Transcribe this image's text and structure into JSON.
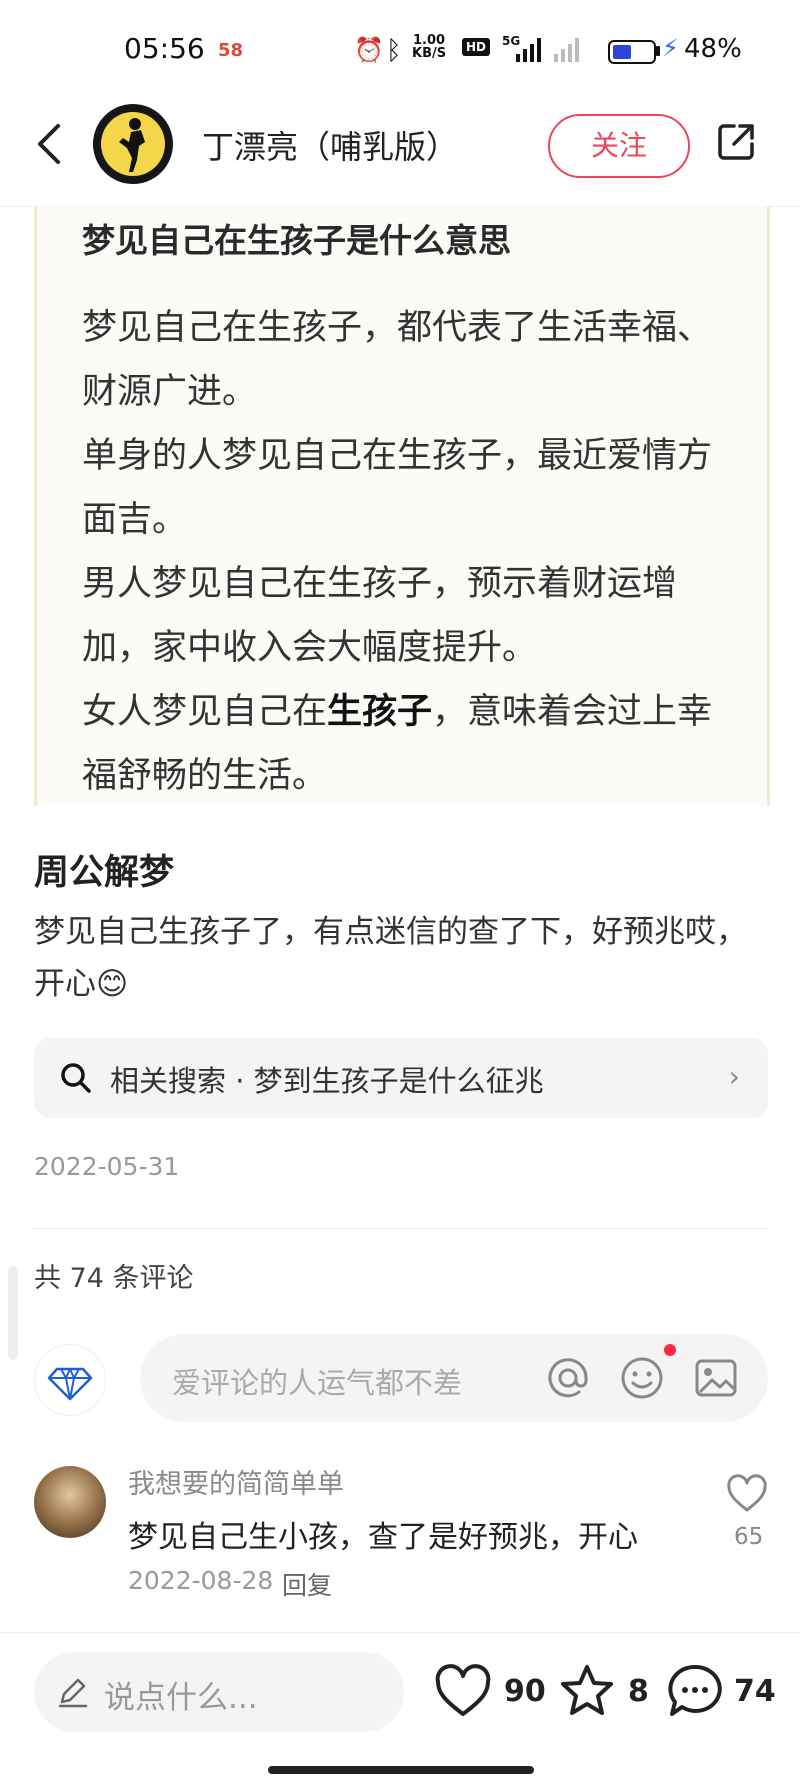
{
  "status_bar": {
    "time": "05:56",
    "notif_badge": "58",
    "net_speed_top": "1.00",
    "net_speed_unit": "KB/S",
    "hd_label": "HD",
    "sig_label": "5G",
    "battery_pct": "48%",
    "battery_level": 0.48
  },
  "header": {
    "author": "丁漂亮（哺乳版）",
    "follow_label": "关注"
  },
  "article_image": {
    "title": "梦见自己在生孩子是什么意思",
    "lines": [
      "梦见自己在生孩子，都代表了生活幸福、财源广进。",
      "单身的人梦见自己在生孩子，最近爱情方面吉。",
      "男人梦见自己在生孩子，预示着财运增加，家中收入会大幅度提升。"
    ],
    "last_line_prefix": "女人梦见自己在",
    "last_line_bold": "生孩子",
    "last_line_suffix": "，意味着会过上幸福舒畅的生活。"
  },
  "post": {
    "title": "周公解梦",
    "body": "梦见自己生孩子了，有点迷信的查了下，好预兆哎，开心😊"
  },
  "related_search": {
    "label": "相关搜索 · 梦到生孩子是什么征兆",
    "arrow": "›"
  },
  "post_date": "2022-05-31",
  "comments": {
    "count_label": "共 74 条评论",
    "input_placeholder": "爱评论的人运气都不差",
    "items": [
      {
        "user": "我想要的简简单单",
        "text": "梦见自己生小孩，查了是好预兆，开心",
        "date": "2022-08-28",
        "reply_label": "回复",
        "likes": "65"
      }
    ]
  },
  "bottom_bar": {
    "input_placeholder": "说点什么...",
    "likes": "90",
    "stars": "8",
    "comments": "74"
  },
  "colors": {
    "accent_red": "#e8485a",
    "notif_dot": "#ff2742",
    "battery_blue": "#2b45d6"
  }
}
